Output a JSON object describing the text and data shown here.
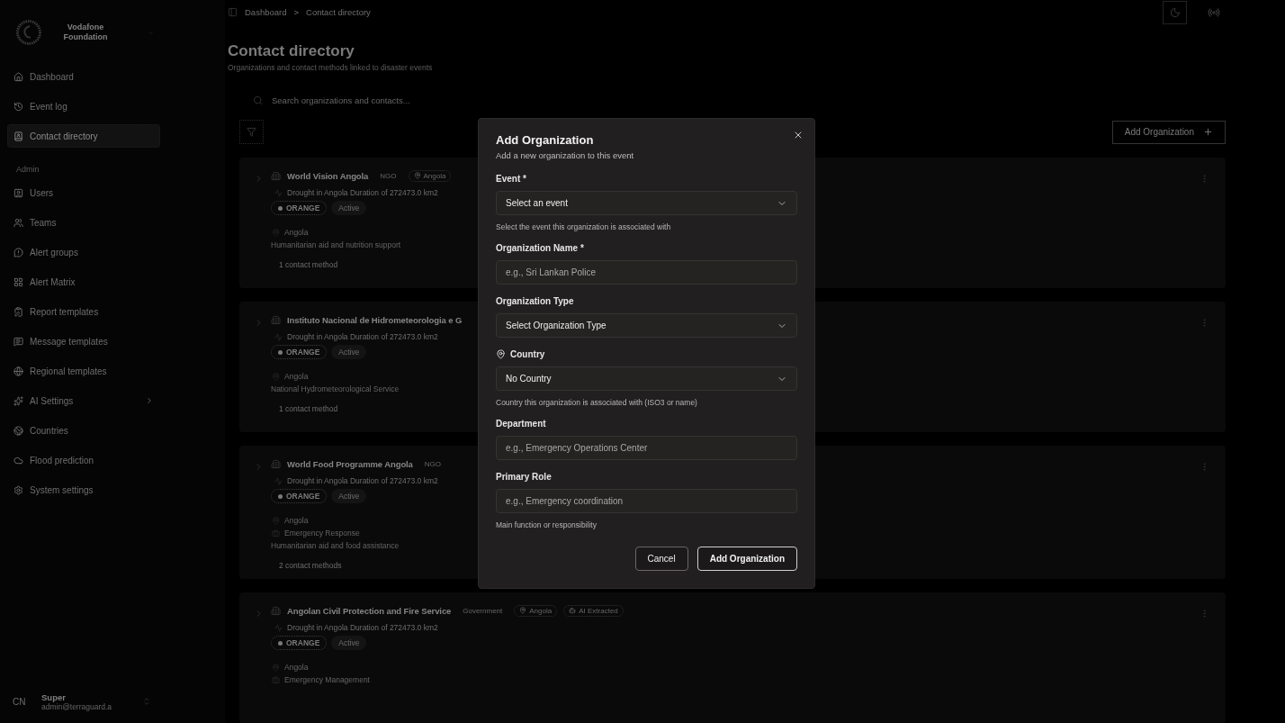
{
  "sidebar": {
    "brand": "Vodafone Foundation",
    "nav": [
      {
        "label": "Dashboard",
        "selected": false
      },
      {
        "label": "Event log",
        "selected": false
      },
      {
        "label": "Contact directory",
        "selected": true
      }
    ],
    "section_label": "Admin",
    "admin_items": [
      {
        "label": "Users",
        "submenu": false
      },
      {
        "label": "Teams",
        "submenu": false
      },
      {
        "label": "Alert groups",
        "submenu": false
      },
      {
        "label": "Alert Matrix",
        "submenu": false
      },
      {
        "label": "Report templates",
        "submenu": false
      },
      {
        "label": "Message templates",
        "submenu": false
      },
      {
        "label": "Regional templates",
        "submenu": false
      },
      {
        "label": "AI Settings",
        "submenu": true
      },
      {
        "label": "Countries",
        "submenu": false
      },
      {
        "label": "Flood prediction",
        "submenu": false
      },
      {
        "label": "System settings",
        "submenu": false
      }
    ],
    "user": {
      "initials": "CN",
      "name": "Super",
      "email": "admin@terraguard.a"
    }
  },
  "breadcrumb": {
    "items": [
      "Dashboard",
      "Contact directory"
    ],
    "separator": ">"
  },
  "page": {
    "title": "Contact directory",
    "subtitle": "Organizations and contact methods linked to disaster events",
    "search_placeholder": "Search organizations and contacts...",
    "add_button": "Add Organization"
  },
  "organizations": [
    {
      "name": "World Vision Angola",
      "tags": [
        {
          "kind": "type",
          "label": "NGO"
        },
        {
          "kind": "country",
          "label": "Angola"
        }
      ],
      "event": "Drought in Angola Duration of 272473.0 km2",
      "severity": "ORANGE",
      "status": "Active",
      "country": "Angola",
      "description": "Humanitarian aid and nutrition support",
      "contacts": "1 contact method"
    },
    {
      "name": "Instituto Nacional de Hidrometeorologia e G",
      "event": "Drought in Angola Duration of 272473.0 km2",
      "severity": "ORANGE",
      "status": "Active",
      "country": "Angola",
      "description": "National Hydrometeorological Service",
      "contacts": "1 contact method"
    },
    {
      "name": "World Food Programme Angola",
      "tags": [
        {
          "kind": "type",
          "label": "NGO"
        }
      ],
      "event": "Drought in Angola Duration of 272473.0 km2",
      "severity": "ORANGE",
      "status": "Active",
      "country": "Angola",
      "department": "Emergency Response",
      "description": "Humanitarian aid and food assistance",
      "contacts": "2 contact methods"
    },
    {
      "name": "Angolan Civil Protection and Fire Service",
      "tags": [
        {
          "kind": "type",
          "label": "Government"
        },
        {
          "kind": "country",
          "label": "Angola"
        },
        {
          "kind": "ai",
          "label": "AI Extracted"
        }
      ],
      "event": "Drought in Angola Duration of 272473.0 km2",
      "severity": "ORANGE",
      "status": "Active",
      "country": "Angola",
      "department": "Emergency Management"
    }
  ],
  "dialog": {
    "title": "Add Organization",
    "subtitle": "Add a new organization to this event",
    "fields": [
      {
        "kind": "select",
        "label": "Event *",
        "value": "Select an event",
        "hint": "Select the event this organization is associated with"
      },
      {
        "kind": "input",
        "label": "Organization Name *",
        "placeholder": "e.g., Sri Lankan Police"
      },
      {
        "kind": "select",
        "label": "Organization Type",
        "value": "Select Organization Type"
      },
      {
        "kind": "country-select",
        "label": "Country",
        "value": "No Country",
        "hint": "Country this organization is associated with (ISO3 or name)"
      },
      {
        "kind": "input",
        "label": "Department",
        "placeholder": "e.g., Emergency Operations Center"
      },
      {
        "kind": "input",
        "label": "Primary Role",
        "placeholder": "e.g., Emergency coordination",
        "hint": "Main function or responsibility"
      }
    ],
    "buttons": [
      {
        "kind": "secondary",
        "label": "Cancel"
      },
      {
        "kind": "primary",
        "label": "Add Organization"
      }
    ]
  }
}
